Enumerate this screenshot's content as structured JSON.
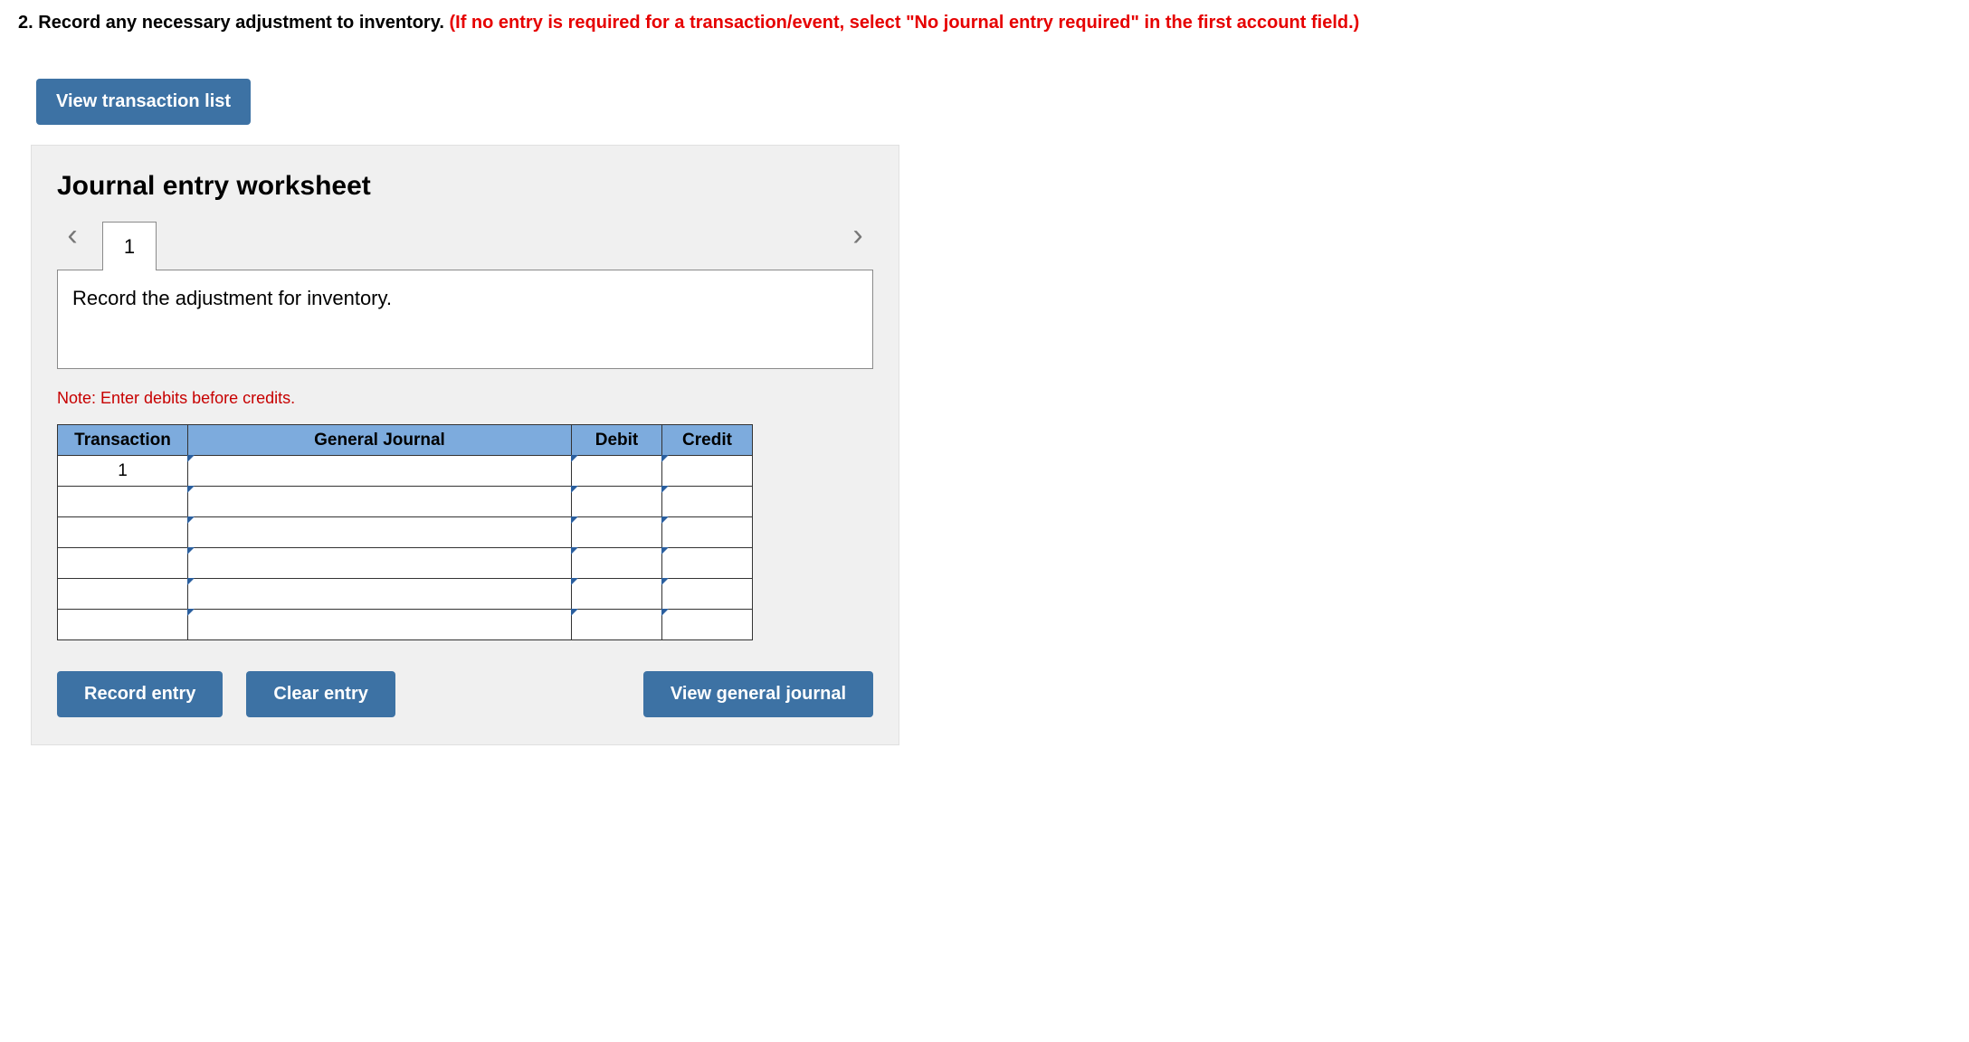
{
  "instruction": {
    "number": "2.",
    "black": "Record any necessary adjustment to inventory.",
    "red": "(If no entry is required for a transaction/event, select \"No journal entry required\" in the first account field.)"
  },
  "buttons": {
    "view_transaction_list": "View transaction list",
    "record_entry": "Record entry",
    "clear_entry": "Clear entry",
    "view_general_journal": "View general journal"
  },
  "panel": {
    "title": "Journal entry worksheet",
    "tab_label": "1",
    "prompt": "Record the adjustment for inventory.",
    "note": "Note: Enter debits before credits."
  },
  "table": {
    "headers": {
      "transaction": "Transaction",
      "journal": "General Journal",
      "debit": "Debit",
      "credit": "Credit"
    },
    "rows": [
      {
        "transaction": "1",
        "journal": "",
        "debit": "",
        "credit": ""
      },
      {
        "transaction": "",
        "journal": "",
        "debit": "",
        "credit": ""
      },
      {
        "transaction": "",
        "journal": "",
        "debit": "",
        "credit": ""
      },
      {
        "transaction": "",
        "journal": "",
        "debit": "",
        "credit": ""
      },
      {
        "transaction": "",
        "journal": "",
        "debit": "",
        "credit": ""
      },
      {
        "transaction": "",
        "journal": "",
        "debit": "",
        "credit": ""
      }
    ]
  }
}
